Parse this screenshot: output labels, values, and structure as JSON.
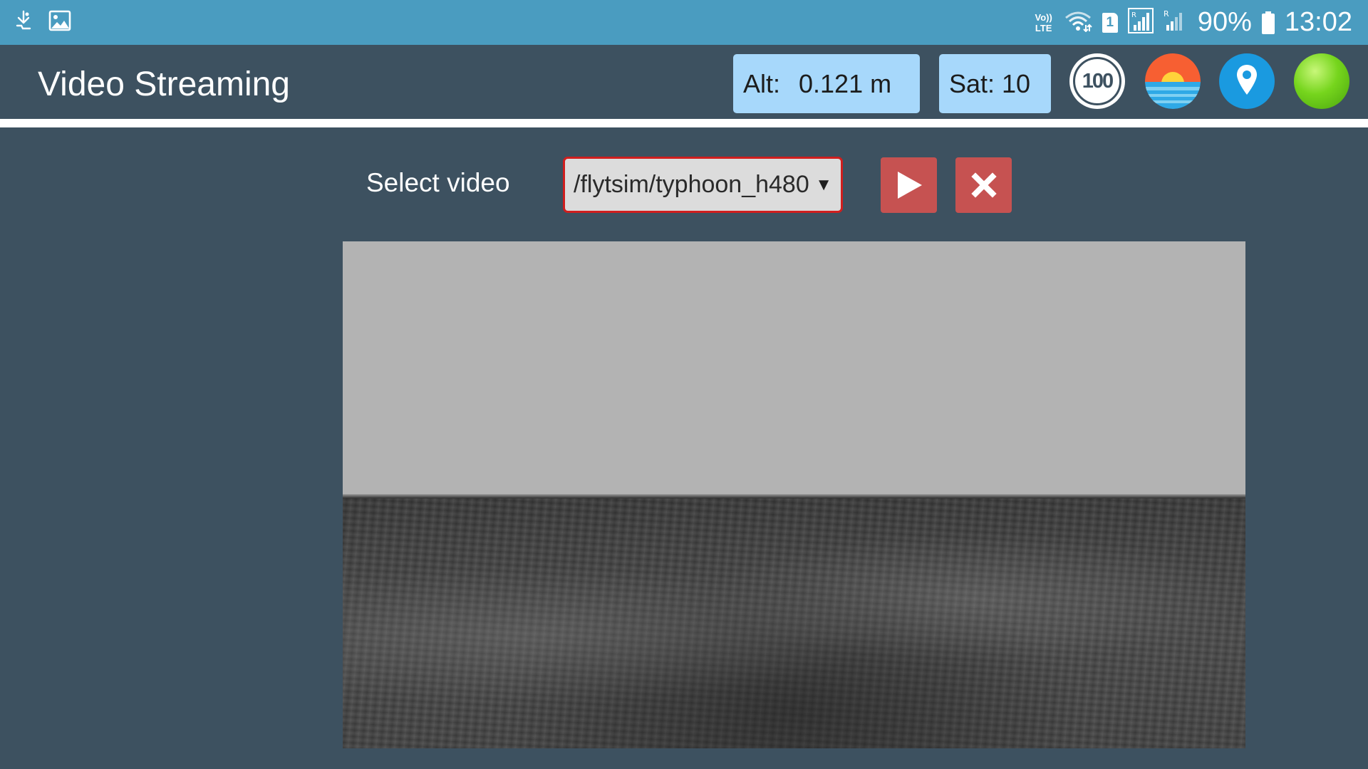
{
  "status_bar": {
    "left_icons": [
      "usb-debug-icon",
      "gallery-icon"
    ],
    "volte_top": "Vo))",
    "volte_bottom": "LTE",
    "sim_slot": "1",
    "battery_percent": "90%",
    "clock": "13:02",
    "icons": [
      "wifi-icon",
      "sim-signal-icon",
      "roaming-signal-icon",
      "battery-icon"
    ]
  },
  "header": {
    "title": "Video Streaming",
    "altitude": {
      "label": "Alt:",
      "value": "0.121 m"
    },
    "satellites": {
      "text": "Sat: 10"
    },
    "speed_limit_icon_text": "100",
    "icons": [
      "speed-limit-icon",
      "horizon-icon",
      "location-pin-icon",
      "connection-status-icon"
    ],
    "colors": {
      "header_bg": "#3d5160",
      "status_bar_bg": "#4a9cc0",
      "telemetry_box_bg": "#a7d8fb",
      "connection_status": "#6fd11a",
      "location_icon_bg": "#1a9ae0"
    }
  },
  "video_controls": {
    "select_label": "Select video",
    "selected_video": "/flytsim/typhoon_h480",
    "play_button_icon": "play-icon",
    "stop_button_icon": "close-icon",
    "colors": {
      "button_bg": "#c65251",
      "select_border": "#d01e1e"
    }
  },
  "video_feed": {
    "content": "simulated-camera-feed"
  }
}
